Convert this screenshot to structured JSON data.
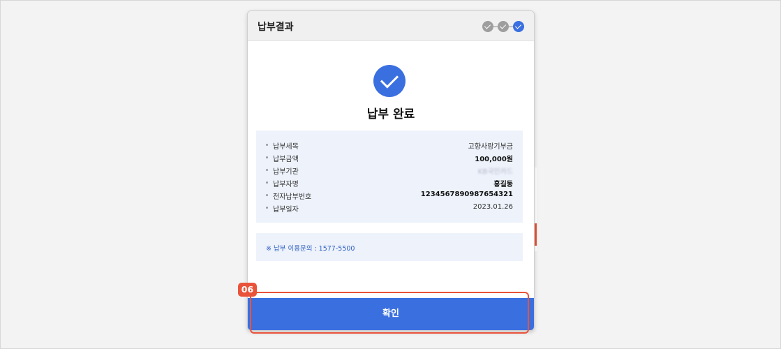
{
  "modal": {
    "title": "납부결과",
    "steps": [
      "check-icon",
      "check-icon",
      "check-icon"
    ],
    "success_title": "납부 완료",
    "info": [
      {
        "label": "납부세목",
        "value": "고향사랑기부금"
      },
      {
        "label": "납부금액",
        "value": "100,000원"
      },
      {
        "label": "납부기관",
        "value": "KB국민카드"
      },
      {
        "label": "납부자명",
        "value": "홍길동"
      },
      {
        "label": "전자납부번호",
        "value": "1234567890987654321"
      },
      {
        "label": "납부일자",
        "value": "2023.01.26"
      }
    ],
    "notice": "※ 납부 이용문의 : 1577-5500",
    "confirm_label": "확인"
  },
  "annotation": {
    "badge": "06"
  },
  "colors": {
    "accent": "#3a6fe0",
    "highlight": "#e9533a",
    "info_bg": "#edf2fb",
    "step_done": "#9e9e9e"
  }
}
